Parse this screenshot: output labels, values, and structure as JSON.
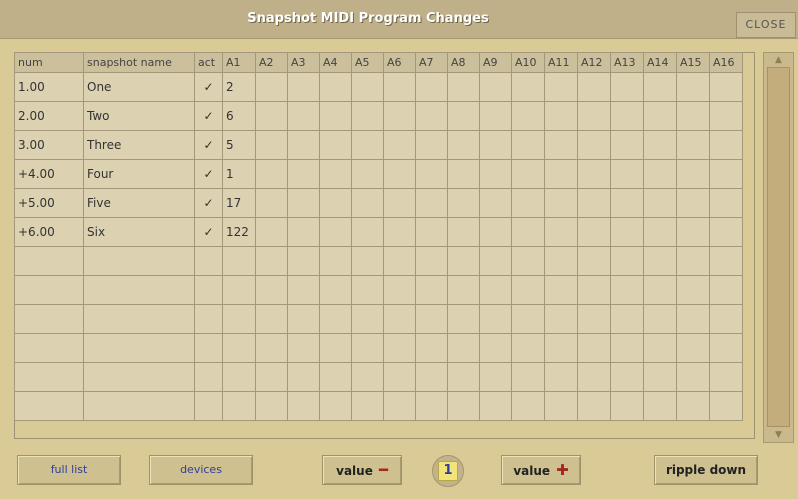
{
  "window": {
    "title": "Snapshot MIDI Program Changes",
    "close_label": "CLOSE"
  },
  "table": {
    "columns": [
      "num",
      "snapshot name",
      "act",
      "A1",
      "A2",
      "A3",
      "A4",
      "A5",
      "A6",
      "A7",
      "A8",
      "A9",
      "A10",
      "A11",
      "A12",
      "A13",
      "A14",
      "A15",
      "A16"
    ],
    "rows": [
      {
        "num": "1.00",
        "name": "One",
        "act": "✓",
        "a1": "2",
        "color": "green"
      },
      {
        "num": "2.00",
        "name": "Two",
        "act": "✓",
        "a1": "6",
        "color": "normal"
      },
      {
        "num": "3.00",
        "name": "Three",
        "act": "✓",
        "a1": "5",
        "color": "normal"
      },
      {
        "num": "+4.00",
        "name": "Four",
        "act": "✓",
        "a1": "1",
        "color": "red"
      },
      {
        "num": "+5.00",
        "name": "Five",
        "act": "✓",
        "a1": "17",
        "color": "red"
      },
      {
        "num": "+6.00",
        "name": "Six",
        "act": "✓",
        "a1": "122",
        "color": "red"
      }
    ],
    "empty_rows": 6
  },
  "buttons": {
    "full_list": "full list",
    "devices": "devices",
    "value_minus": "value",
    "value_plus": "value",
    "ripple_down": "ripple down"
  },
  "counter": {
    "value": "1"
  },
  "icons": {
    "check": "checkmark-icon",
    "minus": "minus-icon",
    "plus": "plus-icon",
    "scroll_up": "scroll-up-icon",
    "scroll_down": "scroll-down-icon"
  },
  "colors": {
    "green": "#3f8f3f",
    "red": "#c8442f",
    "title_bg": "#bfb08a",
    "panel_bg": "#d9ca96"
  }
}
